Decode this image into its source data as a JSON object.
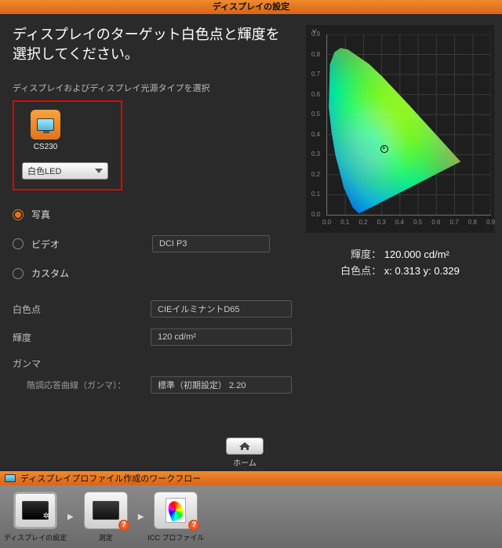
{
  "title": "ディスプレイの設定",
  "heading": "ディスプレイのターゲット白色点と輝度を選択してください。",
  "lightsource_label": "ディスプレイおよびディスプレイ光源タイプを選択",
  "display": {
    "name": "CS230",
    "backlight": "白色LED"
  },
  "modes": [
    "写真",
    "ビデオ",
    "カスタム"
  ],
  "selected_mode_index": 0,
  "video_preset": "DCI P3",
  "fields": {
    "white_point_label": "白色点",
    "white_point_value": "CIEイルミナントD65",
    "brightness_label": "輝度",
    "brightness_value": "120 cd/m²",
    "gamma_label": "ガンマ",
    "tone_curve_label": "階調応答曲線（ガンマ）：",
    "tone_curve_value": "標準（初期設定） 2.20"
  },
  "chart_data": {
    "type": "scatter",
    "title": "",
    "xlabel": "",
    "ylabel": "Y",
    "xlim": [
      0.0,
      0.9
    ],
    "ylim": [
      0.0,
      0.9
    ],
    "x_ticks": [
      0.0,
      0.1,
      0.2,
      0.3,
      0.4,
      0.5,
      0.6,
      0.7,
      0.8,
      0.9
    ],
    "y_ticks": [
      0.0,
      0.1,
      0.2,
      0.3,
      0.4,
      0.5,
      0.6,
      0.7,
      0.8,
      0.9
    ],
    "series": [
      {
        "name": "white_point_target",
        "x": [
          0.313
        ],
        "y": [
          0.329
        ]
      }
    ],
    "spectral_locus": [
      [
        0.175,
        0.005
      ],
      [
        0.14,
        0.035
      ],
      [
        0.091,
        0.133
      ],
      [
        0.045,
        0.295
      ],
      [
        0.023,
        0.413
      ],
      [
        0.008,
        0.538
      ],
      [
        0.014,
        0.75
      ],
      [
        0.039,
        0.812
      ],
      [
        0.074,
        0.834
      ],
      [
        0.115,
        0.826
      ],
      [
        0.23,
        0.754
      ],
      [
        0.302,
        0.692
      ],
      [
        0.444,
        0.555
      ],
      [
        0.735,
        0.265
      ],
      [
        0.175,
        0.005
      ]
    ]
  },
  "readout": {
    "brightness_label": "輝度：",
    "brightness_value": "120.000 cd/m²",
    "white_point_label": "白色点：",
    "white_point_value": "x: 0.313  y: 0.329"
  },
  "home_label": "ホーム",
  "workflow": {
    "header": "ディスプレイプロファイル作成のワークフロー",
    "steps": [
      "ディスプレイの設定",
      "測定",
      "ICC プロファイル"
    ]
  }
}
